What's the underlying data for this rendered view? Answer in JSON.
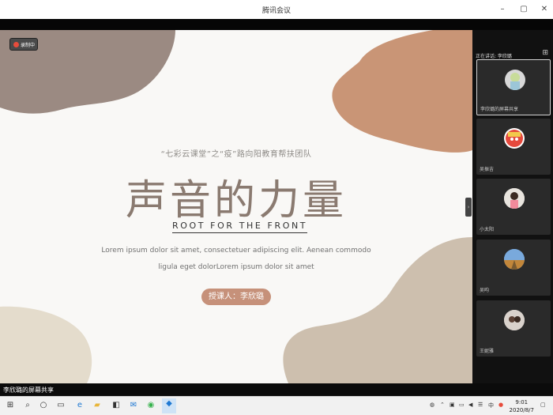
{
  "window": {
    "title": "腾讯会议"
  },
  "recording": {
    "label": "录制中"
  },
  "slide": {
    "subtitle": "“七彩云课堂”之“疫”路向阳教育帮扶团队",
    "headline": "声音的力量",
    "tagline": "ROOT FOR THE FRONT",
    "lorem_line1": "Lorem ipsum dolor sit amet, consectetuer adipiscing elit. Aenean commodo",
    "lorem_line2": "ligula eget dolorLorem ipsum dolor sit amet",
    "teacher": "授课人：李欣璐"
  },
  "panel": {
    "speaking_label": "正在讲话: 李欣璐",
    "participants": [
      {
        "name": "李欣璐的屏幕共享",
        "active": true
      },
      {
        "name": "吴振吉"
      },
      {
        "name": "小太阳"
      },
      {
        "name": "吴昀"
      },
      {
        "name": "王妮雅"
      }
    ]
  },
  "share_bar": {
    "label": "李欣璐的屏幕共享"
  },
  "taskbar": {
    "time": "9:01",
    "date": "2020/8/7",
    "ime": "中",
    "icons": [
      "windows-icon",
      "search-icon",
      "cortana-icon",
      "task-view-icon",
      "edge-icon",
      "file-explorer-icon",
      "store-icon",
      "mail-icon",
      "tencent-meeting-icon"
    ]
  },
  "colors": {
    "accent_brown": "#8a7a70",
    "pill": "#c6917a",
    "blob_taupe": "#9b8a82",
    "blob_terracotta": "#c99576",
    "blob_sand": "#cdbfae"
  }
}
